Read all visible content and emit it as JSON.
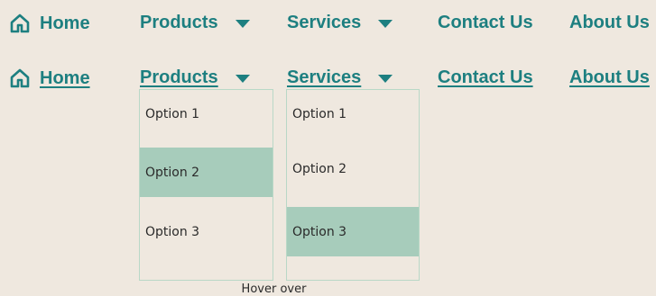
{
  "colors": {
    "background": "#efe8df",
    "accent": "#1d7f80",
    "highlight": "#a7ccbb",
    "dropdown_border": "#b9d8c7",
    "text": "#2a2a2a"
  },
  "default_state": {
    "home": "Home",
    "products": "Products",
    "services": "Services",
    "contact": "Contact Us",
    "about": "About Us",
    "icons": {
      "home": "home-icon",
      "dropdown": "caret-down-icon"
    }
  },
  "hover_state": {
    "home": "Home",
    "products": "Products",
    "services": "Services",
    "contact": "Contact Us",
    "about": "About Us",
    "products_menu": {
      "options": [
        "Option 1",
        "Option 2",
        "Option 3"
      ],
      "selected": "Option 2"
    },
    "services_menu": {
      "options": [
        "Option 1",
        "Option 2",
        "Option 3"
      ],
      "selected": "Option 3"
    }
  },
  "caption": "Hover over"
}
